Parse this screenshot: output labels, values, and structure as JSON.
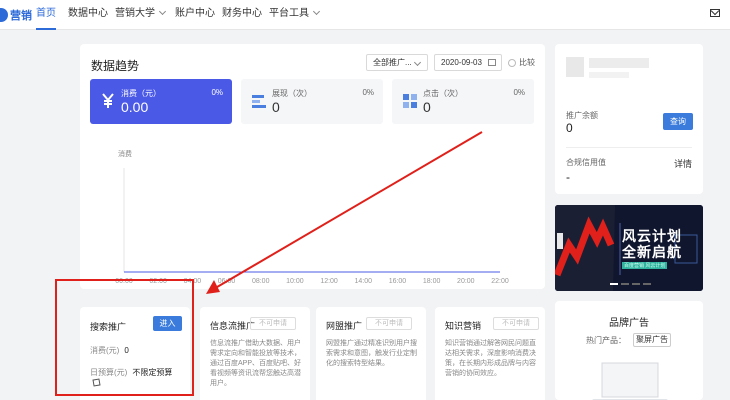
{
  "nav": {
    "logo": "营销",
    "items": [
      {
        "label": "首页",
        "active": true,
        "dropdown": false
      },
      {
        "label": "数据中心",
        "active": false,
        "dropdown": false
      },
      {
        "label": "营销大学",
        "active": false,
        "dropdown": true
      },
      {
        "label": "账户中心",
        "active": false,
        "dropdown": false
      },
      {
        "label": "财务中心",
        "active": false,
        "dropdown": false
      },
      {
        "label": "平台工具",
        "active": false,
        "dropdown": true
      }
    ]
  },
  "trend": {
    "title": "数据趋势",
    "select_value": "全部推广...",
    "date_value": "2020-09-03",
    "compare_label": "比较",
    "metrics": [
      {
        "label": "消费（元）",
        "value": "0.00",
        "percent": "0%",
        "icon": "yuan-icon"
      },
      {
        "label": "展现（次）",
        "value": "0",
        "percent": "0%",
        "icon": "bars-icon"
      },
      {
        "label": "点击（次）",
        "value": "0",
        "percent": "0%",
        "icon": "grid-icon"
      }
    ]
  },
  "chart_data": {
    "type": "line",
    "ylabel": "消费",
    "x": [
      "00:00",
      "02:00",
      "04:00",
      "06:00",
      "08:00",
      "10:00",
      "12:00",
      "14:00",
      "16:00",
      "18:00",
      "20:00",
      "22:00"
    ],
    "series": [
      {
        "values": [
          0,
          0,
          0,
          0,
          0,
          0,
          0,
          0,
          0,
          0,
          0,
          0
        ]
      }
    ]
  },
  "profile": {
    "balance_label": "推广余额",
    "balance_value": "0",
    "query_label": "查询",
    "credit_label": "合规信用值",
    "credit_value": "-",
    "detail_label": "详情"
  },
  "banner": {
    "title_line1": "风云计划",
    "title_line2": "全新启航",
    "subtitle": "百度营销 风云计划"
  },
  "products": [
    {
      "title": "搜索推广",
      "button": "进入",
      "enabled": true,
      "spend_label": "消费(元)",
      "spend_value": "0",
      "budget_label": "日预算(元)",
      "budget_value": "不限定预算"
    },
    {
      "title": "信息流推广",
      "button": "不可申请",
      "enabled": false,
      "desc": "信息流推广借助大数据、用户需求定向和智能投放等技术，通过百度APP、百度贴吧、好看视频等资讯流帮您触达高潜用户。"
    },
    {
      "title": "网盟推广",
      "button": "不可申请",
      "enabled": false,
      "desc": "网盟推广通过精准识别用户搜索需求和意图，触发行业定制化的搜索特型结果。"
    },
    {
      "title": "知识营销",
      "button": "不可申请",
      "enabled": false,
      "desc": "知识营销通过解答网民问题直达相关需求，深度影响消费决策，在长期内形成品牌与内容营销的协同效应。"
    }
  ],
  "brand": {
    "title": "品牌广告",
    "hot_label": "热门产品：",
    "hot_tag": "聚屏广告"
  },
  "colors": {
    "primary": "#3a7bdc",
    "metric_active": "#4a59e6",
    "annotation": "#e0201a"
  }
}
